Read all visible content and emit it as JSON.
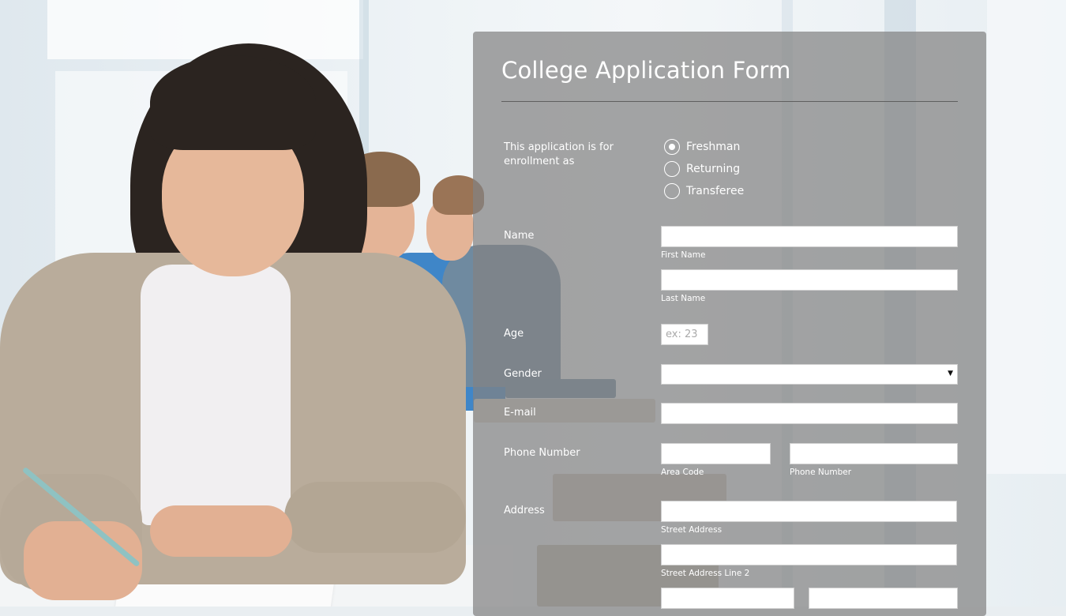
{
  "form": {
    "title": "College Application Form",
    "enrollment": {
      "label": "This application is for enrollment as",
      "options": [
        "Freshman",
        "Returning",
        "Transferee"
      ],
      "selected": "Freshman"
    },
    "name": {
      "label": "Name",
      "first_sublabel": "First Name",
      "last_sublabel": "Last Name",
      "first_value": "",
      "last_value": ""
    },
    "age": {
      "label": "Age",
      "placeholder": "ex: 23",
      "value": ""
    },
    "gender": {
      "label": "Gender",
      "selected": ""
    },
    "email": {
      "label": "E-mail",
      "value": ""
    },
    "phone": {
      "label": "Phone Number",
      "area_sublabel": "Area Code",
      "number_sublabel": "Phone Number"
    },
    "address": {
      "label": "Address",
      "street_sublabel": "Street Address",
      "street2_sublabel": "Street Address Line 2"
    }
  },
  "colors": {
    "panel": "#828282",
    "text": "#ffffff",
    "field": "#ffffff"
  }
}
